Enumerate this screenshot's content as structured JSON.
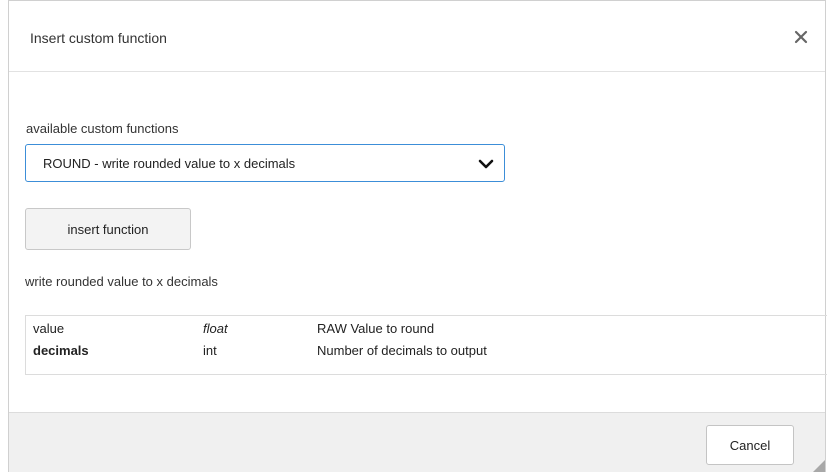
{
  "dialog": {
    "title": "Insert custom function",
    "close_icon": "close-icon"
  },
  "form": {
    "select_label": "available custom functions",
    "selected_function": "ROUND - write rounded value to x decimals",
    "insert_button_label": "insert function",
    "function_description": "write rounded value to x decimals"
  },
  "params": [
    {
      "name": "value",
      "type": "float",
      "description": "RAW Value to round"
    },
    {
      "name": "decimals",
      "type": "int",
      "description": "Number of decimals to output"
    }
  ],
  "footer": {
    "cancel_label": "Cancel"
  },
  "colors": {
    "accent_border": "#3c8ed8",
    "footer_bg": "#f0f0f0"
  }
}
